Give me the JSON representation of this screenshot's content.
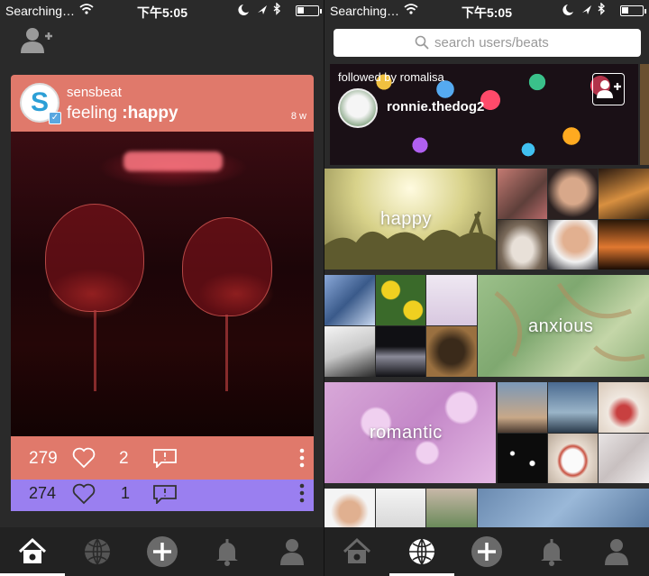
{
  "status_bar": {
    "carrier": "Searching…",
    "time": "下午5:05",
    "battery_level": 0.35
  },
  "feed_screen": {
    "post": {
      "username": "sensbeat",
      "avatar_letter": "S",
      "feeling_prefix": "feeling ",
      "mood": ":happy",
      "age": "8 w",
      "likes": "279",
      "comments": "2"
    },
    "next_post": {
      "likes": "274",
      "comments": "1"
    }
  },
  "explore_screen": {
    "search": {
      "placeholder": "search users/beats"
    },
    "suggested_user": {
      "followed_by": "followed by romalisa",
      "username": "ronnie.thedog2"
    },
    "moods": {
      "happy": "happy",
      "anxious": "anxious",
      "romantic": "romantic"
    }
  },
  "tab_bar": {
    "tabs": [
      "home-icon",
      "globe-icon",
      "add-icon",
      "bell-icon",
      "profile-icon"
    ],
    "left_active": "home",
    "right_active": "explore"
  },
  "colors": {
    "post_accent": "#e0796b",
    "next_post_accent": "#9a7ff0",
    "background": "#2a2a2a"
  }
}
